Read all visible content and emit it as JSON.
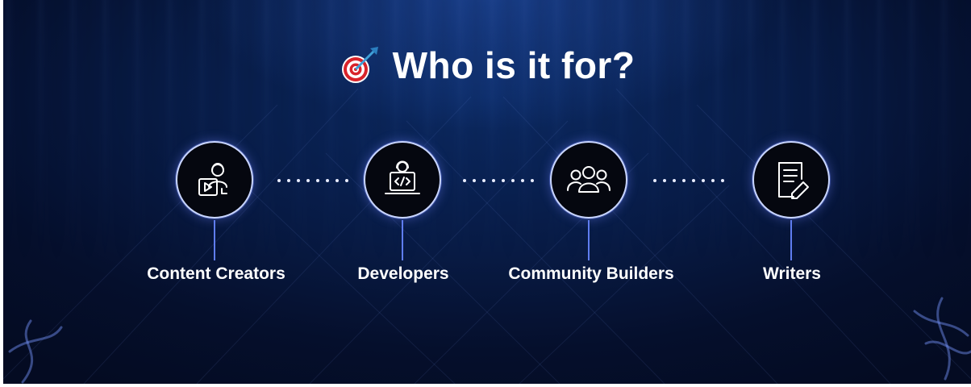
{
  "title": {
    "emoji": "🎯",
    "text": "Who is it for?"
  },
  "audiences": [
    {
      "label": "Content Creators",
      "icon": "content-creator-icon"
    },
    {
      "label": "Developers",
      "icon": "developer-laptop-icon"
    },
    {
      "label": "Community Builders",
      "icon": "community-group-icon"
    },
    {
      "label": "Writers",
      "icon": "document-pen-icon"
    }
  ],
  "colors": {
    "background": "#081b45",
    "accent_line": "#5f7df0",
    "circle_border": "#c9d6ff",
    "text": "#ffffff"
  }
}
